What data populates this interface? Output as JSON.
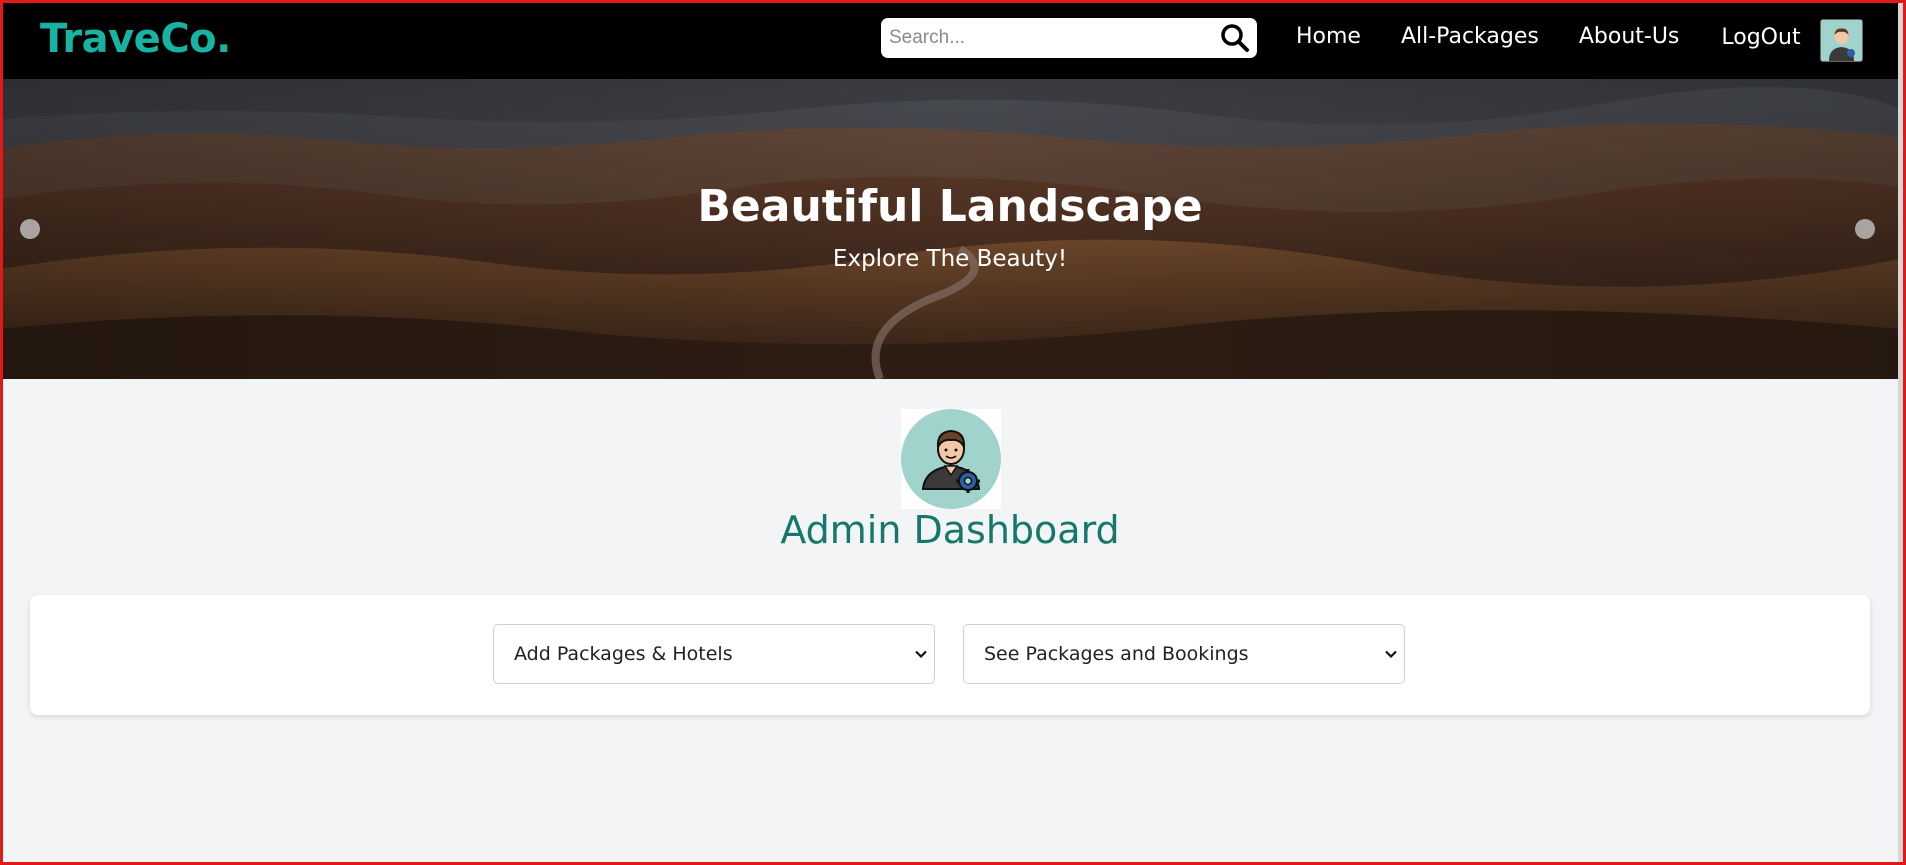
{
  "navbar": {
    "brand": "TraveCo.",
    "search_placeholder": "Search...",
    "links": [
      "Home",
      "All-Packages",
      "About-Us",
      "LogOut"
    ]
  },
  "hero": {
    "title": "Beautiful Landscape",
    "subtitle": "Explore The Beauty!"
  },
  "admin": {
    "title": "Admin Dashboard"
  },
  "selects": [
    {
      "value": "Add Packages & Hotels"
    },
    {
      "value": "See Packages and Bookings"
    }
  ],
  "colors": {
    "brand": "#17b3a3",
    "heading": "#14786b",
    "navbar_bg": "#000000",
    "page_bg": "#f3f4f6",
    "frame_border": "#e11919"
  },
  "icons": [
    "search-icon",
    "user-avatar-icon",
    "admin-gear-icon",
    "chevron-down-icon"
  ]
}
